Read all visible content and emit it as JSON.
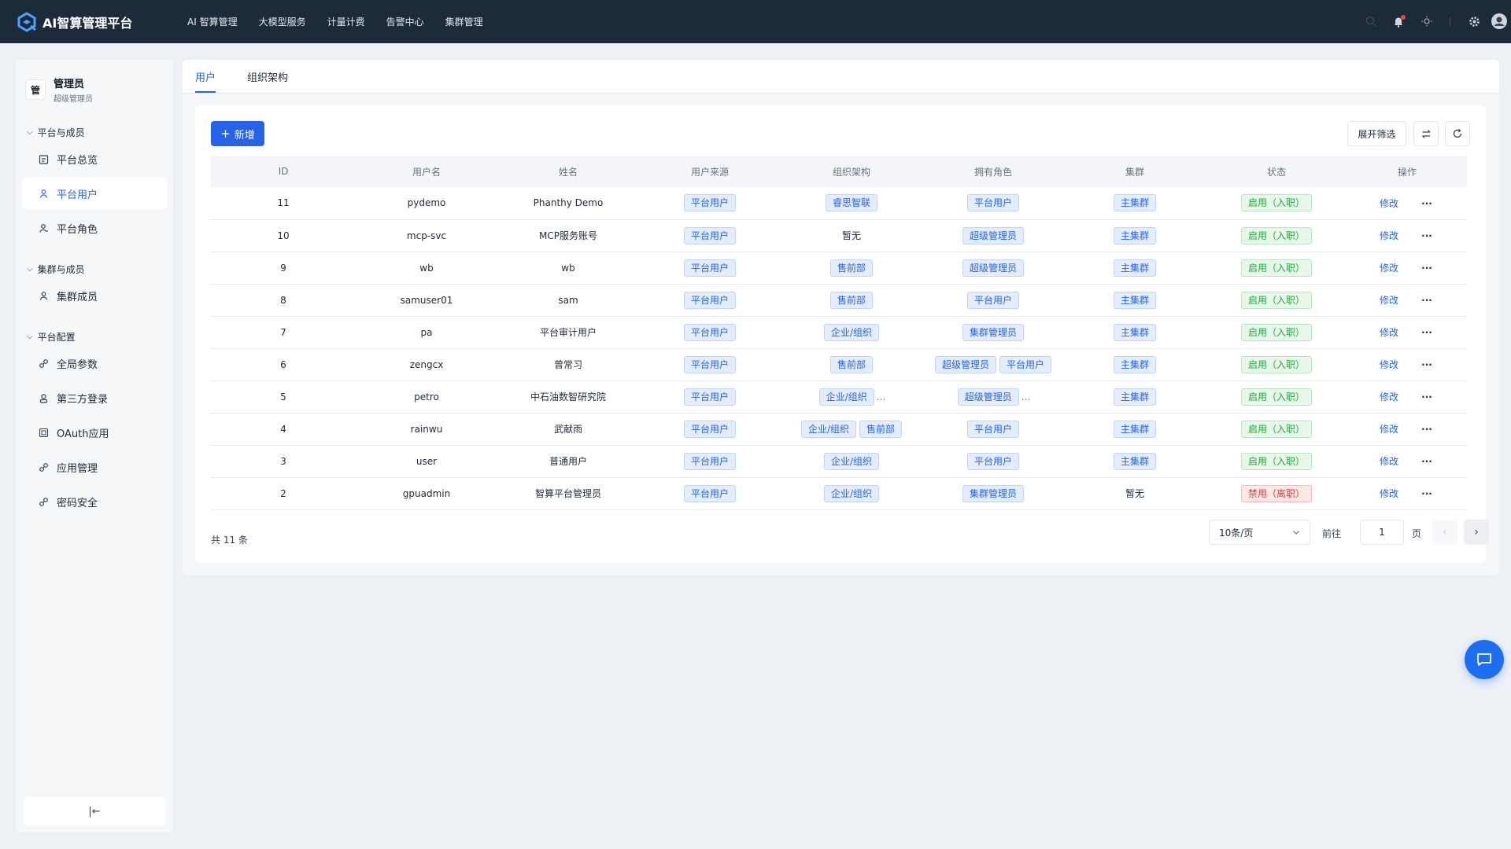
{
  "app": {
    "title": "AI智算管理平台",
    "top_nav": [
      "AI 智算管理",
      "大模型服务",
      "计量计费",
      "告警中心",
      "集群管理"
    ]
  },
  "sidebar": {
    "admin": {
      "avatar_char": "管",
      "name": "管理员",
      "role": "超级管理员"
    },
    "groups": [
      {
        "title": "平台与成员",
        "items": [
          {
            "label": "平台总览",
            "icon": "clipboard-icon"
          },
          {
            "label": "平台用户",
            "icon": "users-icon",
            "active": true
          },
          {
            "label": "平台角色",
            "icon": "user-role-icon"
          }
        ]
      },
      {
        "title": "集群与成员",
        "items": [
          {
            "label": "集群成员",
            "icon": "users-icon"
          }
        ]
      },
      {
        "title": "平台配置",
        "items": [
          {
            "label": "全局参数",
            "icon": "link-icon"
          },
          {
            "label": "第三方登录",
            "icon": "id-badge-icon"
          },
          {
            "label": "OAuth应用",
            "icon": "app-grid-icon"
          },
          {
            "label": "应用管理",
            "icon": "link-icon"
          },
          {
            "label": "密码安全",
            "icon": "link-icon"
          }
        ]
      }
    ],
    "collapse_glyph": "|←"
  },
  "tabs": [
    {
      "label": "用户",
      "active": true
    },
    {
      "label": "组织架构",
      "active": false
    }
  ],
  "toolbar": {
    "new_label": "新增",
    "filter_label": "展开筛选"
  },
  "table": {
    "columns": [
      "ID",
      "用户名",
      "姓名",
      "用户来源",
      "组织架构",
      "拥有角色",
      "集群",
      "状态",
      "操作"
    ],
    "rows": [
      {
        "id": "11",
        "username": "pydemo",
        "name": "Phanthy Demo",
        "source": "平台用户",
        "org": [
          "睿思智联"
        ],
        "org_more": false,
        "roles": [
          "平台用户"
        ],
        "roles_more": false,
        "cluster": "主集群",
        "cluster_tag": true,
        "status": "启用（入职）",
        "status_type": "green",
        "action": "修改"
      },
      {
        "id": "10",
        "username": "mcp-svc",
        "name": "MCP服务账号",
        "source": "平台用户",
        "org": [],
        "org_text": "暂无",
        "org_more": false,
        "roles": [
          "超级管理员"
        ],
        "roles_more": false,
        "cluster": "主集群",
        "cluster_tag": true,
        "status": "启用（入职）",
        "status_type": "green",
        "action": "修改"
      },
      {
        "id": "9",
        "username": "wb",
        "name": "wb",
        "source": "平台用户",
        "org": [
          "售前部"
        ],
        "org_more": false,
        "roles": [
          "超级管理员"
        ],
        "roles_more": false,
        "cluster": "主集群",
        "cluster_tag": true,
        "status": "启用（入职）",
        "status_type": "green",
        "action": "修改"
      },
      {
        "id": "8",
        "username": "samuser01",
        "name": "sam",
        "source": "平台用户",
        "org": [
          "售前部"
        ],
        "org_more": false,
        "roles": [
          "平台用户"
        ],
        "roles_more": false,
        "cluster": "主集群",
        "cluster_tag": true,
        "status": "启用（入职）",
        "status_type": "green",
        "action": "修改"
      },
      {
        "id": "7",
        "username": "pa",
        "name": "平台审计用户",
        "source": "平台用户",
        "org": [
          "企业/组织"
        ],
        "org_more": false,
        "roles": [
          "集群管理员"
        ],
        "roles_more": false,
        "cluster": "主集群",
        "cluster_tag": true,
        "status": "启用（入职）",
        "status_type": "green",
        "action": "修改"
      },
      {
        "id": "6",
        "username": "zengcx",
        "name": "曾常习",
        "source": "平台用户",
        "org": [
          "售前部"
        ],
        "org_more": false,
        "roles": [
          "超级管理员",
          "平台用户"
        ],
        "roles_more": false,
        "cluster": "主集群",
        "cluster_tag": true,
        "status": "启用（入职）",
        "status_type": "green",
        "action": "修改"
      },
      {
        "id": "5",
        "username": "petro",
        "name": "中石油数智研究院",
        "source": "平台用户",
        "org": [
          "企业/组织"
        ],
        "org_more": true,
        "roles": [
          "超级管理员"
        ],
        "roles_more": true,
        "cluster": "主集群",
        "cluster_tag": true,
        "status": "启用（入职）",
        "status_type": "green",
        "action": "修改"
      },
      {
        "id": "4",
        "username": "rainwu",
        "name": "武献雨",
        "source": "平台用户",
        "org": [
          "企业/组织",
          "售前部"
        ],
        "org_more": false,
        "roles": [
          "平台用户"
        ],
        "roles_more": false,
        "cluster": "主集群",
        "cluster_tag": true,
        "status": "启用（入职）",
        "status_type": "green",
        "action": "修改"
      },
      {
        "id": "3",
        "username": "user",
        "name": "普通用户",
        "source": "平台用户",
        "org": [
          "企业/组织"
        ],
        "org_more": false,
        "roles": [
          "平台用户"
        ],
        "roles_more": false,
        "cluster": "主集群",
        "cluster_tag": true,
        "status": "启用（入职）",
        "status_type": "green",
        "action": "修改"
      },
      {
        "id": "2",
        "username": "gpuadmin",
        "name": "智算平台管理员",
        "source": "平台用户",
        "org": [
          "企业/组织"
        ],
        "org_more": false,
        "roles": [
          "集群管理员"
        ],
        "roles_more": false,
        "cluster": "暂无",
        "cluster_tag": false,
        "status": "禁用（离职）",
        "status_type": "red",
        "action": "修改"
      }
    ]
  },
  "pagination": {
    "total_text": "共 11 条",
    "page_size": "10条/页",
    "goto_label": "前往",
    "current_page": "1",
    "page_label": "页"
  },
  "colors": {
    "topbar": "#1d2a3a",
    "accent": "#2563eb",
    "success": "#22a83a",
    "danger": "#e03b3b"
  }
}
